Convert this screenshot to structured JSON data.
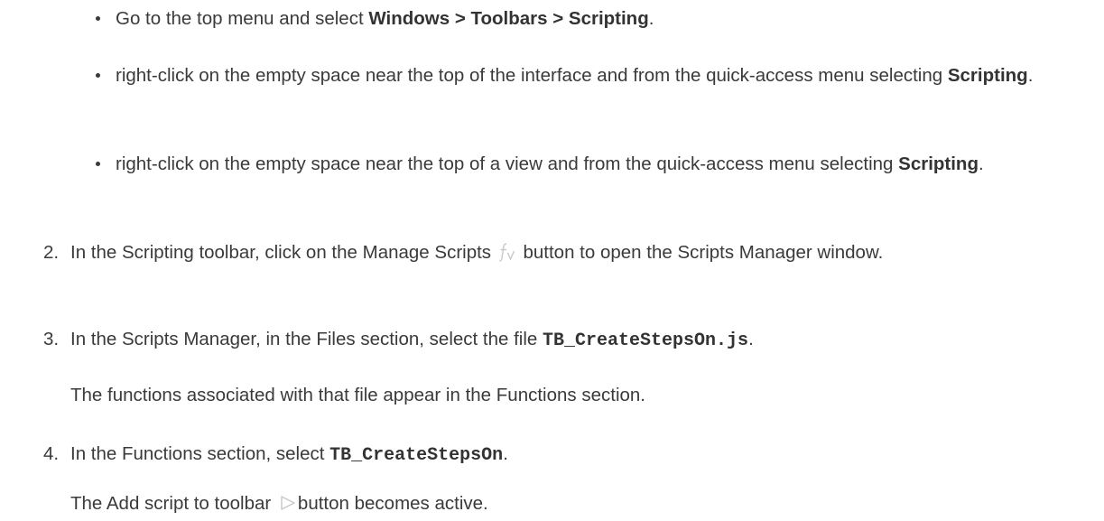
{
  "bullets": [
    {
      "pre": "Go to the top menu and select ",
      "bold": "Windows > Toolbars > Scripting",
      "post": "."
    },
    {
      "pre": "right-click on the empty space near the top of the interface and from the quick-access menu selecting ",
      "bold": "Scripting",
      "post": "."
    },
    {
      "pre": "right-click on the empty space near the top of a view and from the quick-access menu selecting ",
      "bold": "Scripting",
      "post": "."
    }
  ],
  "steps": {
    "s2": {
      "num": "2.",
      "pre": "In the Scripting toolbar, click on the Manage Scripts",
      "icon": "function-icon",
      "post": "button to open the Scripts Manager window."
    },
    "s3": {
      "num": "3.",
      "pre": "In the Scripts Manager, in the Files section, select the file ",
      "code": "TB_CreateStepsOn.js",
      "post": ".",
      "para": "The functions associated with that file appear in the Functions section."
    },
    "s4": {
      "num": "4.",
      "pre": "In the Functions section, select ",
      "code": "TB_CreateStepsOn",
      "post": ".",
      "para_pre": "The Add script to toolbar",
      "icon": "play-icon",
      "para_post": "button becomes active."
    }
  }
}
